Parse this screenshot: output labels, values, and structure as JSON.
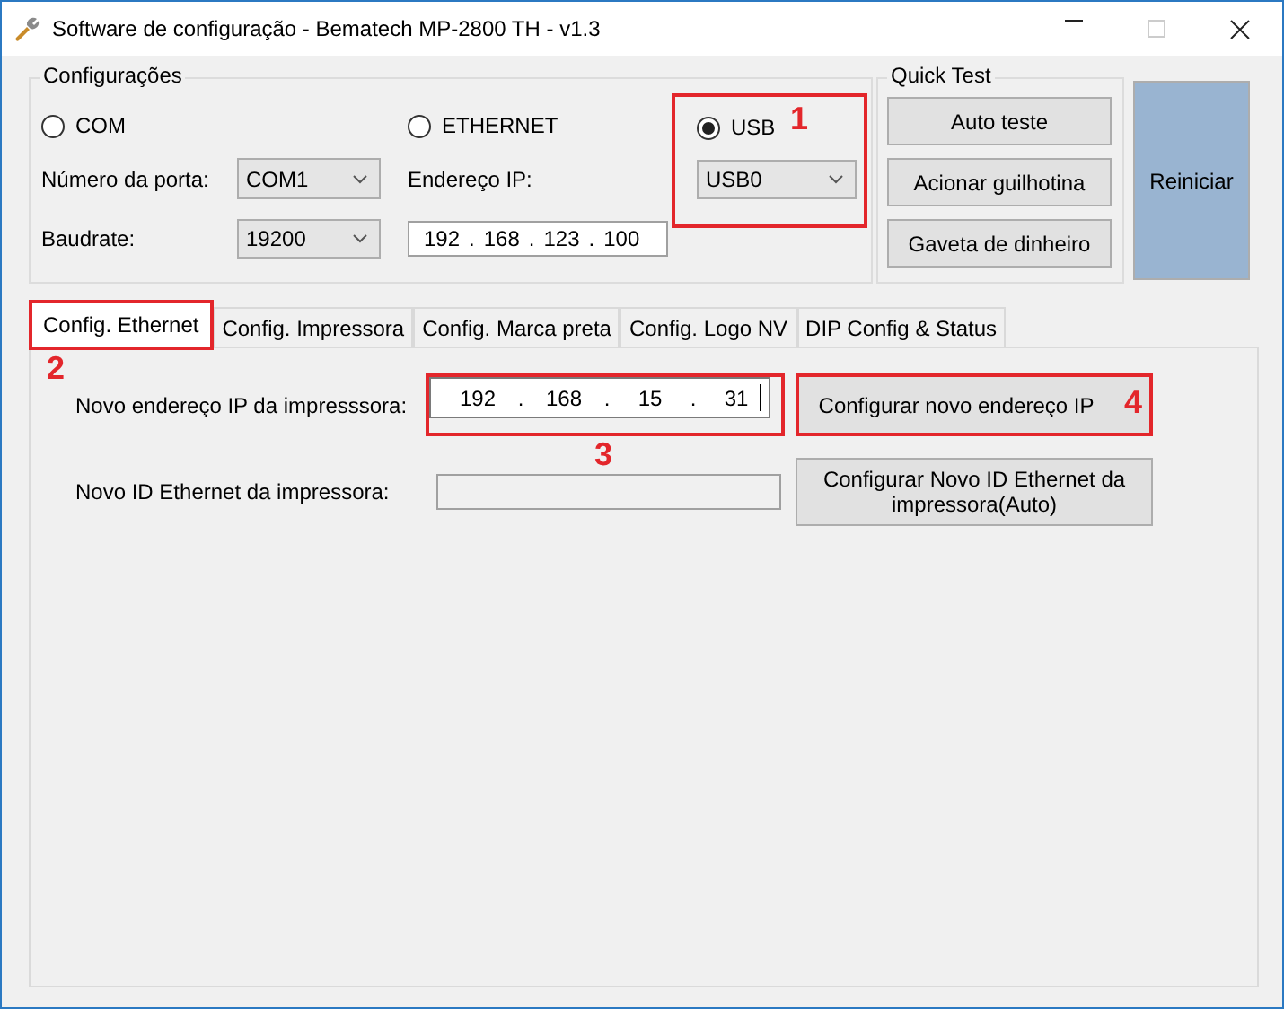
{
  "window": {
    "title": "Software de configuração - Bematech MP-2800 TH - v1.3"
  },
  "configuracoes": {
    "title": "Configurações",
    "options": [
      {
        "label": "COM",
        "selected": false
      },
      {
        "label": "ETHERNET",
        "selected": false
      },
      {
        "label": "USB",
        "selected": true,
        "annotation": "1"
      }
    ],
    "port_label": "Número da porta:",
    "port_value": "COM1",
    "baud_label": "Baudrate:",
    "baud_value": "19200",
    "ip_label": "Endereço IP:",
    "ip_octets": [
      "192",
      "168",
      "123",
      "100"
    ],
    "ip_separator": ".",
    "usb_value": "USB0"
  },
  "quick_test": {
    "title": "Quick Test",
    "buttons": [
      "Auto teste",
      "Acionar guilhotina",
      "Gaveta de dinheiro"
    ]
  },
  "restart_button": "Reiniciar",
  "tabs": [
    {
      "label": "Config. Ethernet",
      "selected": true,
      "annotation": "2"
    },
    {
      "label": "Config. Impressora",
      "selected": false
    },
    {
      "label": "Config. Marca preta",
      "selected": false
    },
    {
      "label": "Config. Logo NV",
      "selected": false
    },
    {
      "label": "DIP Config & Status",
      "selected": false
    }
  ],
  "ethernet_panel": {
    "rows": [
      {
        "label": "Novo endereço IP da impresssora:",
        "field": {
          "kind": "ip",
          "octets": [
            "192",
            "168",
            "15",
            "31"
          ],
          "separator": ".",
          "focused": true,
          "annotation": "3"
        },
        "button": {
          "label": "Configurar novo endereço IP",
          "annotation": "4"
        }
      },
      {
        "label": "Novo ID Ethernet da impressora:",
        "field": {
          "kind": "text",
          "focused": false
        },
        "button": {
          "label": "Configurar Novo ID Ethernet da impressora(Auto)"
        }
      }
    ]
  }
}
